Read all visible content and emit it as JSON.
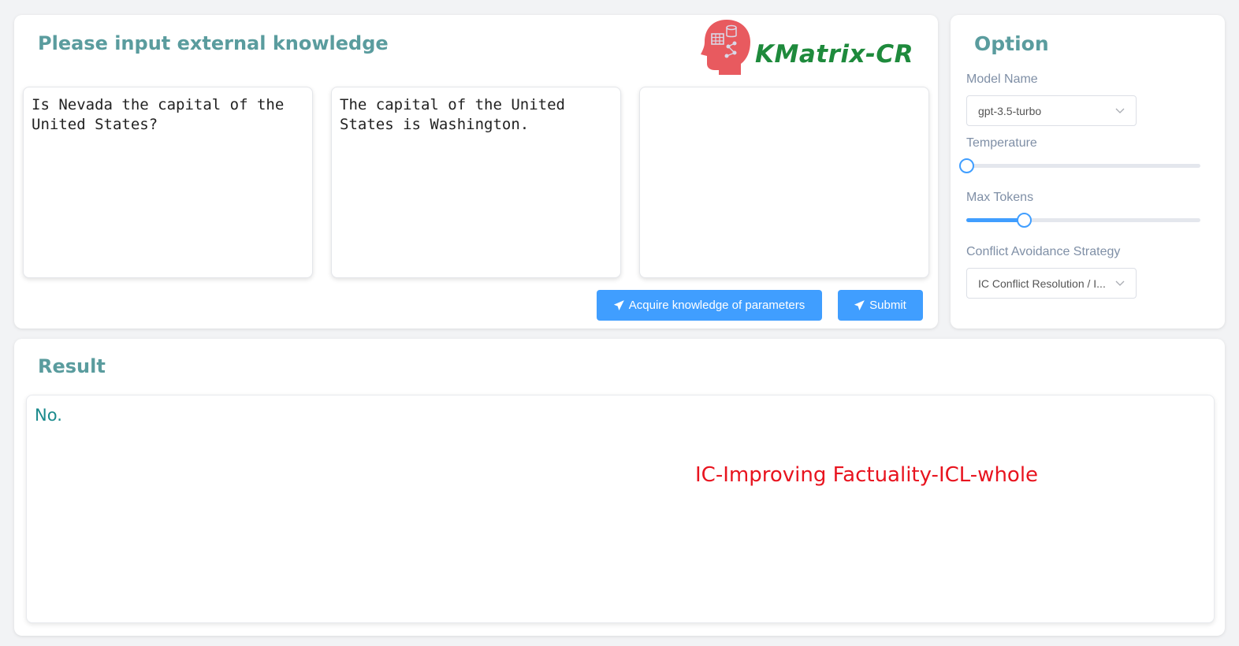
{
  "input_panel": {
    "title": "Please input external knowledge",
    "logo_text": "KMatrix-CR",
    "knowledge_boxes": [
      "Is Nevada the capital of the United States?",
      "The capital of the United States is Washington.",
      ""
    ],
    "buttons": {
      "acquire_label": "Acquire knowledge of parameters",
      "submit_label": "Submit"
    }
  },
  "option_panel": {
    "title": "Option",
    "model_name_label": "Model Name",
    "model_name_value": "gpt-3.5-turbo",
    "temperature_label": "Temperature",
    "temperature_fraction": 0.0,
    "max_tokens_label": "Max Tokens",
    "max_tokens_fraction": 0.245,
    "strategy_label": "Conflict Avoidance Strategy",
    "strategy_value": "IC Conflict Resolution / I..."
  },
  "result_panel": {
    "title": "Result",
    "output": "No.",
    "annotation": "IC-Improving Factuality-ICL-whole"
  },
  "colors": {
    "accent": "#409eff",
    "title": "#5a9c9e",
    "logo": "#1e8a3c",
    "logo_icon": "#e85a5f",
    "annotation": "#e8141f",
    "result_text": "#1a8a8c"
  },
  "icons": [
    "brain-head-icon",
    "paper-plane-icon",
    "chevron-down-icon"
  ]
}
